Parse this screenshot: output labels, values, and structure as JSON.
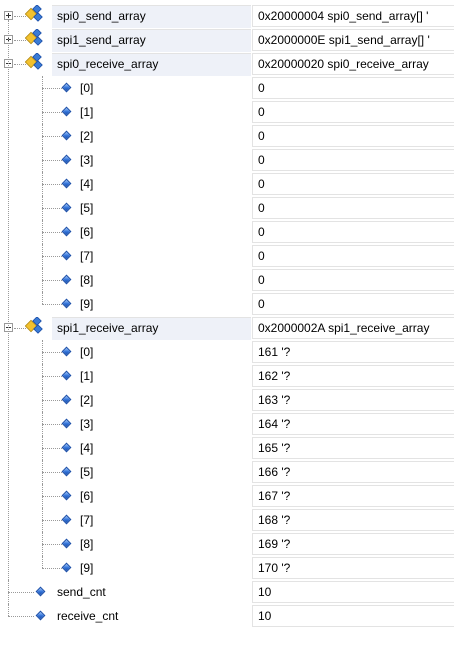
{
  "watch": {
    "rows": [
      {
        "name": "spi0_send_array",
        "value": "0x20000004 spi0_send_array[] '",
        "kind": "struct",
        "expanded": false
      },
      {
        "name": "spi1_send_array",
        "value": "0x2000000E spi1_send_array[] '",
        "kind": "struct",
        "expanded": false
      },
      {
        "name": "spi0_receive_array",
        "value": "0x20000020 spi0_receive_array",
        "kind": "struct",
        "expanded": true
      },
      {
        "name": "[0]",
        "value": "0",
        "kind": "element"
      },
      {
        "name": "[1]",
        "value": "0",
        "kind": "element"
      },
      {
        "name": "[2]",
        "value": "0",
        "kind": "element"
      },
      {
        "name": "[3]",
        "value": "0",
        "kind": "element"
      },
      {
        "name": "[4]",
        "value": "0",
        "kind": "element"
      },
      {
        "name": "[5]",
        "value": "0",
        "kind": "element"
      },
      {
        "name": "[6]",
        "value": "0",
        "kind": "element"
      },
      {
        "name": "[7]",
        "value": "0",
        "kind": "element"
      },
      {
        "name": "[8]",
        "value": "0",
        "kind": "element"
      },
      {
        "name": "[9]",
        "value": "0",
        "kind": "element"
      },
      {
        "name": "spi1_receive_array",
        "value": "0x2000002A spi1_receive_array",
        "kind": "struct",
        "expanded": true
      },
      {
        "name": "[0]",
        "value": "161 '?",
        "kind": "element"
      },
      {
        "name": "[1]",
        "value": "162 '?",
        "kind": "element"
      },
      {
        "name": "[2]",
        "value": "163 '?",
        "kind": "element"
      },
      {
        "name": "[3]",
        "value": "164 '?",
        "kind": "element"
      },
      {
        "name": "[4]",
        "value": "165 '?",
        "kind": "element"
      },
      {
        "name": "[5]",
        "value": "166 '?",
        "kind": "element"
      },
      {
        "name": "[6]",
        "value": "167 '?",
        "kind": "element"
      },
      {
        "name": "[7]",
        "value": "168 '?",
        "kind": "element"
      },
      {
        "name": "[8]",
        "value": "169 '?",
        "kind": "element"
      },
      {
        "name": "[9]",
        "value": "170 '?",
        "kind": "element"
      },
      {
        "name": "send_cnt",
        "value": "10",
        "kind": "scalar"
      },
      {
        "name": "receive_cnt",
        "value": "10",
        "kind": "scalar"
      }
    ]
  },
  "icons": {
    "expand": "expand-plus-icon",
    "collapse": "collapse-minus-icon",
    "struct": "struct-variable-icon",
    "member": "member-diamond-icon"
  },
  "colors": {
    "selected_row_bg": "#eef1f8",
    "grid_line": "#e3e3e3",
    "tree_line": "#9a9a9a",
    "member_icon": "#2e6fd6",
    "struct_icon_yellow": "#f2c12e",
    "struct_icon_blue": "#3a7bd5"
  }
}
